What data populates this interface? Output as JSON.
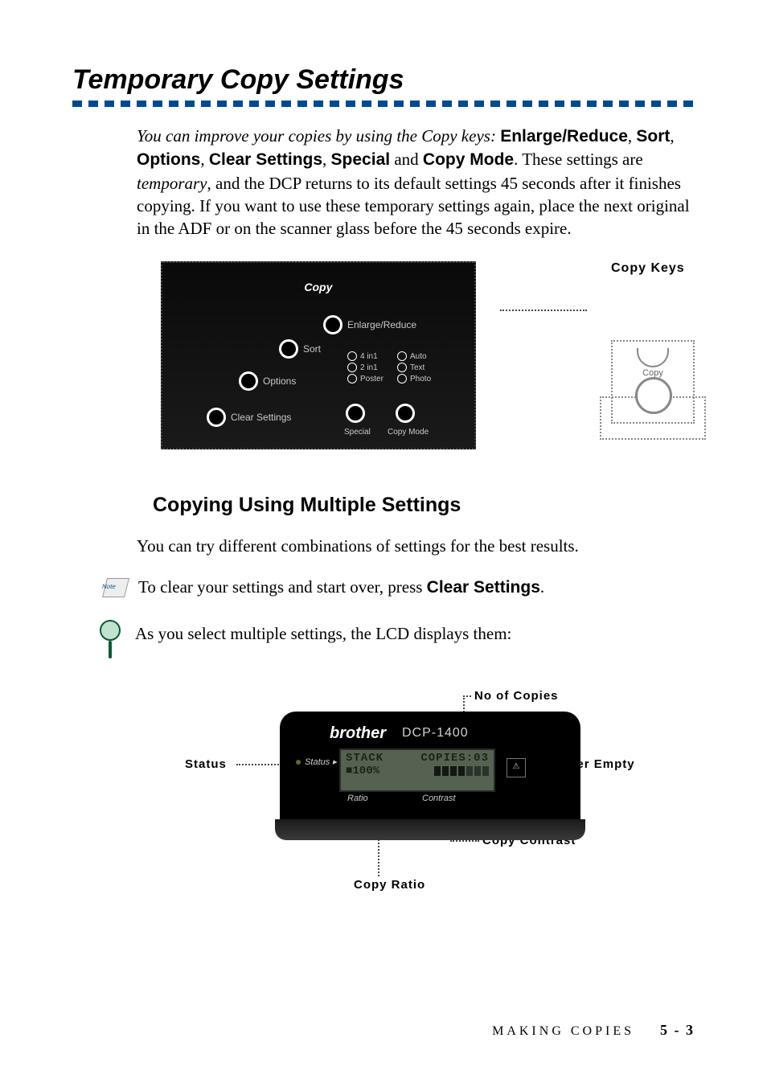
{
  "title": "Temporary Copy Settings",
  "intro": {
    "lead_italic": "You can improve your copies by using the Copy keys:",
    "keys": [
      "Enlarge/Reduce",
      "Sort",
      "Options",
      "Clear Settings",
      "Special",
      "Copy Mode"
    ],
    "mid1": ". These settings are ",
    "temp_italic": "temporary",
    "rest": ", and the DCP returns to its default settings 45 seconds after it finishes copying. If you want to use these temporary settings again, place the next original in the ADF or on the scanner glass before the 45 seconds expire."
  },
  "panel": {
    "header": "Copy",
    "buttons": {
      "enlarge_reduce": "Enlarge/Reduce",
      "sort": "Sort",
      "options": "Options",
      "clear_settings": "Clear Settings",
      "special": "Special",
      "copy_mode": "Copy Mode"
    },
    "modes_left": [
      "4 in1",
      "2 in1",
      "Poster"
    ],
    "modes_right": [
      "Auto",
      "Text",
      "Photo"
    ],
    "side_label": "Copy Keys",
    "mini_label": "Copy"
  },
  "section2": {
    "heading": "Copying Using Multiple Settings",
    "line1": "You can try different combinations of settings for the best results.",
    "note_icon": "Note",
    "note_pre": "To clear your settings and start over, press ",
    "note_bold": "Clear Settings",
    "note_post": ".",
    "tip": "As you select multiple settings, the LCD displays them:"
  },
  "lcd": {
    "brand": "brother",
    "model": "DCP-1400",
    "status_word": "Status",
    "status_arrow": "▸",
    "screen_row1_left": "STACK",
    "screen_row1_right": "COPIES:03",
    "screen_row2_left": "■100%",
    "under_ratio": "Ratio",
    "under_contrast": "Contrast",
    "toner_glyph": "⚠",
    "labels": {
      "no_copies": "No of Copies",
      "status": "Status",
      "toner_empty": "Toner Empty",
      "copy_contrast": "Copy Contrast",
      "copy_ratio": "Copy Ratio"
    }
  },
  "footer": {
    "section": "MAKING COPIES",
    "page": "5 - 3"
  }
}
